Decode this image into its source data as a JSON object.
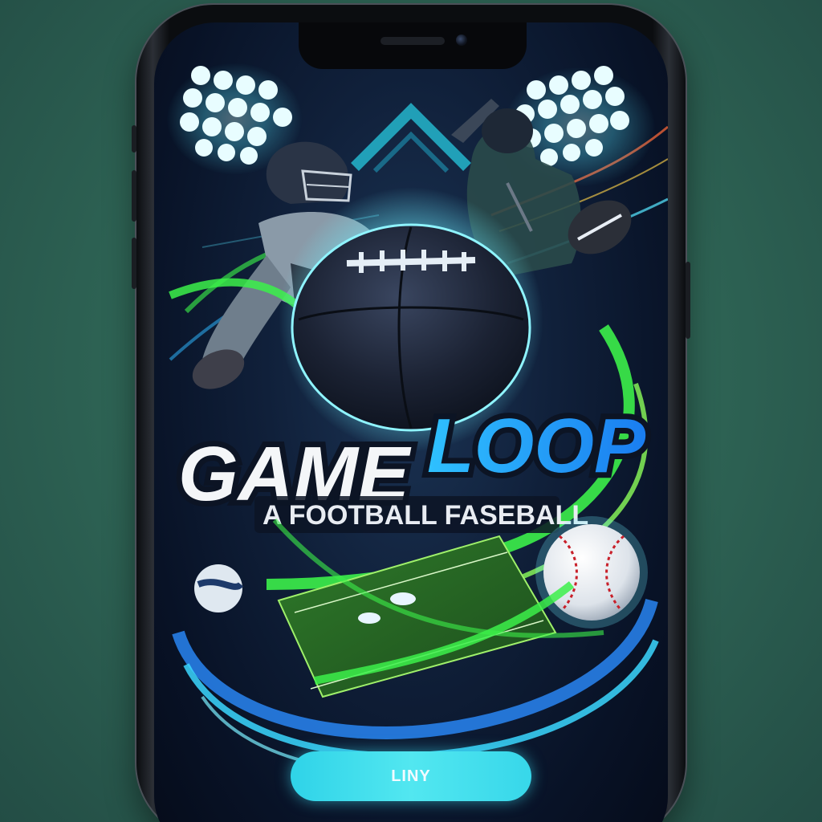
{
  "app": {
    "logo_word_1": "GAME",
    "logo_word_2": "LOOP",
    "tagline": "A FOOTBALL FASEBALL"
  },
  "cta_button": {
    "label": "LINY"
  },
  "colors": {
    "background": "#2f6656",
    "screen_bg": "#0c1a33",
    "accent_cyan": "#38d8ea",
    "accent_green": "#3cf04a",
    "logo_white": "#f4f6f8",
    "logo_blue": "#26a8ff"
  },
  "icons": [
    "stadium-light-icon",
    "football-icon",
    "baseball-icon",
    "helmet-icon",
    "field-icon",
    "bat-icon"
  ]
}
